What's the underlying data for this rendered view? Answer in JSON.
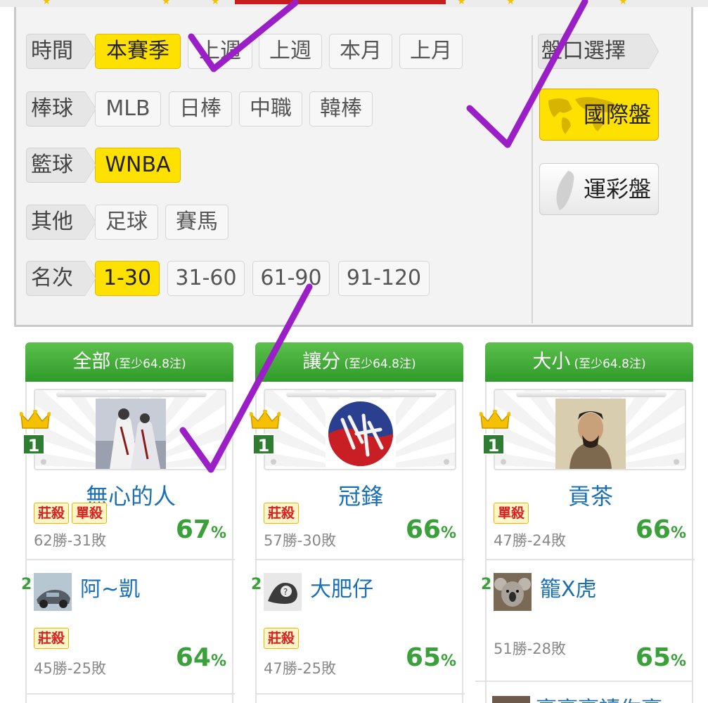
{
  "filters": {
    "time": {
      "label": "時間",
      "options": [
        "本賽季",
        "上週",
        "上週",
        "本月",
        "上月"
      ],
      "selected": 0
    },
    "baseball": {
      "label": "棒球",
      "options": [
        "MLB",
        "日棒",
        "中職",
        "韓棒"
      ]
    },
    "basketball": {
      "label": "籃球",
      "options": [
        "WNBA"
      ],
      "selected": 0
    },
    "other": {
      "label": "其他",
      "options": [
        "足球",
        "賽馬"
      ]
    },
    "rank": {
      "label": "名次",
      "options": [
        "1-30",
        "31-60",
        "61-90",
        "91-120"
      ],
      "selected": 0
    }
  },
  "market": {
    "label": "盤口選擇",
    "international": "國際盤",
    "lottery": "運彩盤",
    "selected": "international"
  },
  "columns": [
    {
      "title": "全部",
      "subtitle": "(至少64.8注)",
      "first": {
        "rank": "1",
        "name": "無心的人",
        "badges": [
          "莊殺",
          "單殺"
        ],
        "record": "62勝-31敗",
        "pct": "67",
        "pct_unit": "%"
      },
      "second": {
        "rank": "2",
        "name": "阿~凱",
        "badges": [
          "莊殺"
        ],
        "record": "45勝-25敗",
        "pct": "64",
        "pct_unit": "%"
      }
    },
    {
      "title": "讓分",
      "subtitle": "(至少64.8注)",
      "first": {
        "rank": "1",
        "name": "冠鋒",
        "badges": [
          "莊殺"
        ],
        "record": "57勝-30敗",
        "pct": "66",
        "pct_unit": "%"
      },
      "second": {
        "rank": "2",
        "name": "大肥仔",
        "badges": [
          "莊殺"
        ],
        "record": "47勝-25敗",
        "pct": "65",
        "pct_unit": "%"
      }
    },
    {
      "title": "大小",
      "subtitle": "(至少64.8注)",
      "first": {
        "rank": "1",
        "name": "貢茶",
        "badges": [
          "單殺"
        ],
        "record": "47勝-24敗",
        "pct": "66",
        "pct_unit": "%"
      },
      "second": {
        "rank": "2",
        "name": "籠X虎",
        "badges": [],
        "record": "51勝-28敗",
        "pct": "65",
        "pct_unit": "%"
      },
      "third_partial": {
        "name": "豪豪豪讀你豪"
      }
    }
  ],
  "colors": {
    "selected": "#ffe100",
    "header_green": "#3aa03a",
    "name_blue": "#1b6fb3",
    "check_purple": "#9b1fc6"
  }
}
